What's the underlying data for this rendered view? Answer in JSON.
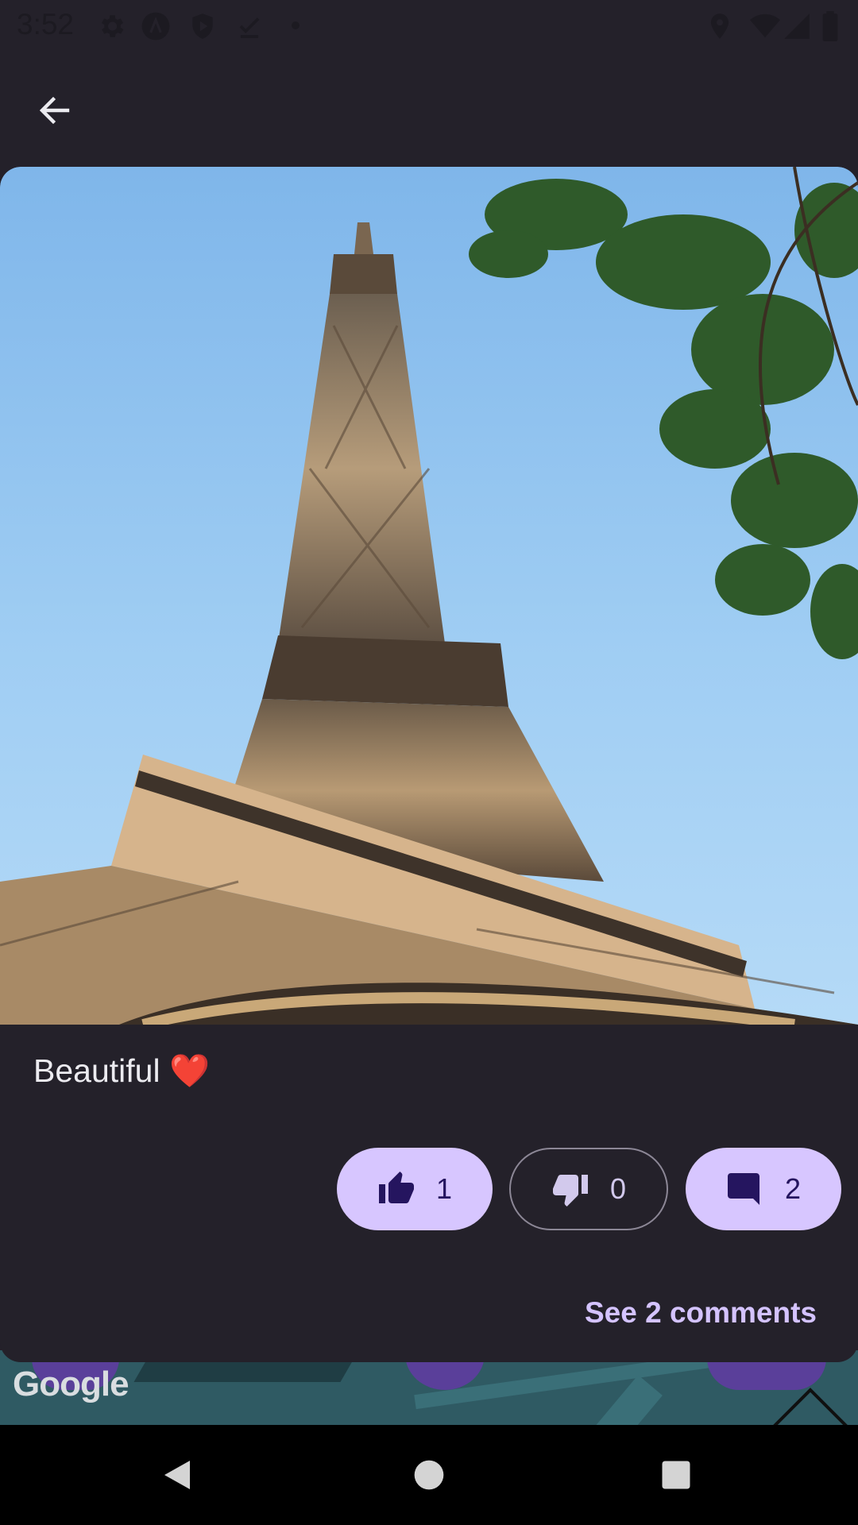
{
  "status_bar": {
    "time": "3:52",
    "left_icons": [
      "settings-icon",
      "app-a-icon",
      "shield-play-icon",
      "download-done-icon",
      "dot-icon"
    ],
    "right_icons": [
      "location-icon",
      "wifi-icon",
      "signal-icon",
      "battery-icon"
    ]
  },
  "app_bar": {
    "back_icon": "arrow-back-icon"
  },
  "post": {
    "photo_alt": "Eiffel Tower photo",
    "caption": "Beautiful ❤️",
    "actions": {
      "likes": "1",
      "dislikes": "0",
      "comments": "2"
    },
    "see_comments_label": "See 2 comments"
  },
  "map": {
    "watermark": "Google"
  },
  "colors": {
    "background": "#24212a",
    "pill_filled": "#d7c6ff",
    "pill_text": "#25155f",
    "link": "#d4c3ff"
  }
}
